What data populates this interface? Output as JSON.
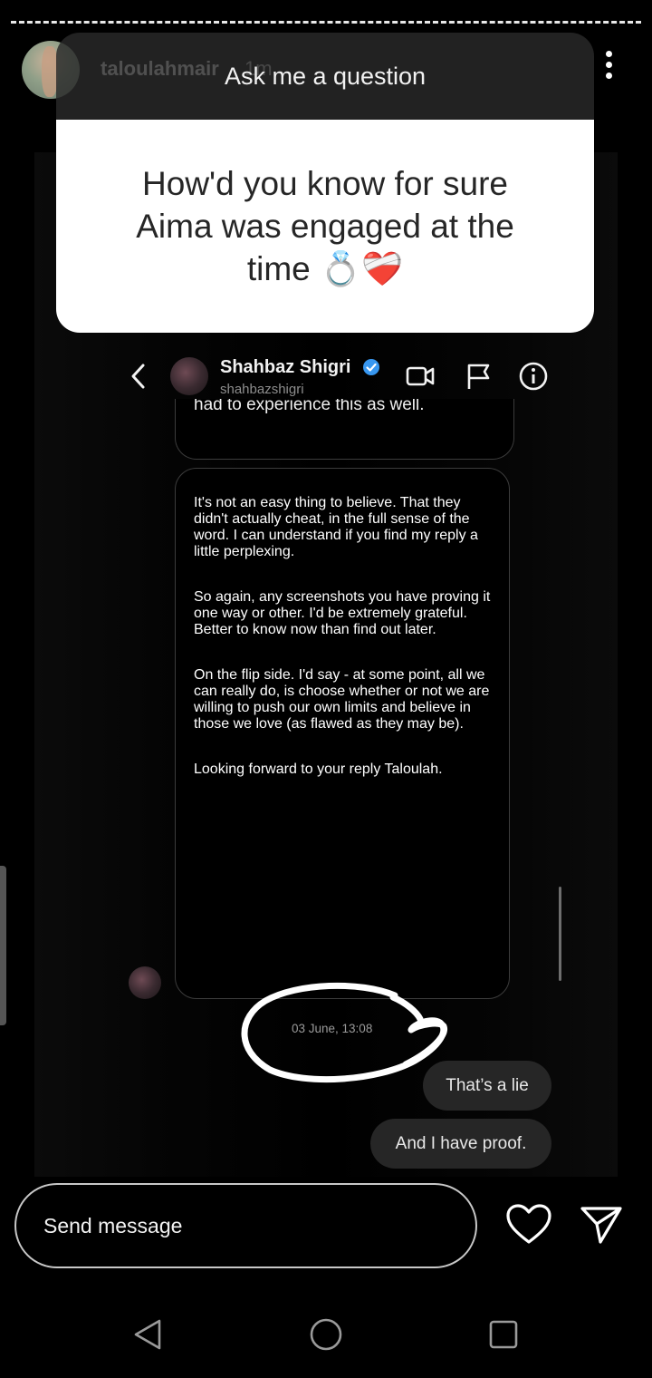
{
  "story": {
    "username": "taloulahmair",
    "time_ago": "1m"
  },
  "question_sticker": {
    "header": "Ask me a question",
    "question": "How'd you know for sure Aima was engaged at the time 💍❤️‍🩹"
  },
  "dm_screenshot": {
    "contact_name": "Shahbaz Shigri",
    "contact_handle": "shahbazshigri",
    "cut_off_text": "had to experience this as well.",
    "message_paragraphs": [
      "It's not an easy thing to believe. That they didn't actually cheat, in the full sense of the word. I can understand if you find my reply a little perplexing.",
      "So again, any screenshots you have proving it one way or other. I'd be extremely grateful. Better to know now than find out later.",
      "On the flip side. I'd say - at some point, all we can really do, is choose whether or not we are willing to push our own limits and believe in those we love (as flawed as they may be).",
      "Looking forward to your reply Taloulah."
    ],
    "timestamp": "03 June, 13:08",
    "sent_messages": [
      "That’s a lie",
      "And I have proof."
    ]
  },
  "reply_bar": {
    "placeholder": "Send message"
  },
  "icons": {
    "verified_color": "#3897f0",
    "heart": "heart-icon",
    "send": "send-icon"
  }
}
